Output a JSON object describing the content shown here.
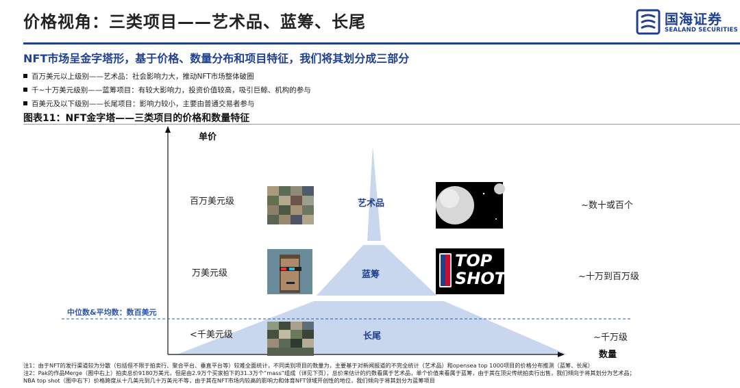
{
  "header": {
    "title": "价格视角：三类项目——艺术品、蓝筹、长尾",
    "logo_cn": "国海证券",
    "logo_en": "SEALAND SECURITIES"
  },
  "subtitle": "NFT市场呈金字塔形，基于价格、数量分布和项目特征，我们将其划分成三部分",
  "bullets": [
    "百万美元以上级别——艺术品：社会影响力大，推动NFT市场整体破圈",
    "千~十万美元级别——蓝筹项目：有较大影响力，投资价值较高，吸引巨鲸、机构的参与",
    "百美元及以下级别——长尾项目：影响力较小，主要由普通交易者参与"
  ],
  "figure": {
    "title": "图表11：NFT金字塔——三类项目的价格和数量特征",
    "y_axis_label": "单价",
    "x_axis_label": "数量",
    "median_label": "中位数&平均数：数百美元",
    "tiers": [
      {
        "price": "百万美元级",
        "name": "艺术品",
        "count": "~数十或百个",
        "left_image": "mosaic-collage-image",
        "right_image": "spheres-artwork-image"
      },
      {
        "price": "万美元级",
        "name": "蓝筹",
        "count": "~十万到百万级",
        "left_image": "cryptopunk-image",
        "right_image": "nba-topshot-logo"
      },
      {
        "price": "<千美元级",
        "name": "长尾",
        "count": "~千万级",
        "left_image": "mass-collage-image",
        "right_image": ""
      }
    ],
    "topshot_text": [
      "TOP",
      "SHOT"
    ]
  },
  "notes": [
    "注1：由于NFT的发行渠道较为分散（包括但不限于拍卖行、聚合平台、垂直平台等）较难全面统计，不同类别项目的数量为，主要基于对新闻报道的不完全统计（艺术品）和opensea top 1000项目的价格分布推测（蓝筹、长尾）",
    "注2：Pak的作品Merge（图中右上）拍卖总价9180万美元，但是由2.9万个买家拍下的31.3万个“mass”组成（详见下页），总价来估计的约数看属于艺术品，单个价值来看属于蓝筹，由于其在顶尖传统拍卖行出售，我们倾向于将其划分为艺术品；",
    "NBA top shot（图中右下）价格跨度从十几美元到几十万美元不等，由于其在NFT市场内较高的影响力和体育NFT领域开创性的地位，我们倾向于将其划分为蓝筹项目"
  ],
  "colors": {
    "brand": "#1f3f8f",
    "pyramid": "#c9d7ee",
    "median_line": "#2a56b0"
  }
}
